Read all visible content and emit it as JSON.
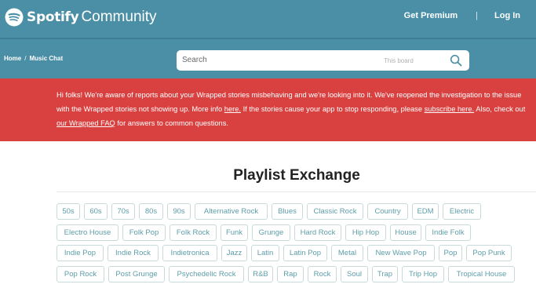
{
  "header": {
    "brand_name": "Spotify",
    "brand_suffix": "Community",
    "get_premium": "Get Premium",
    "separator": "|",
    "login": "Log In"
  },
  "breadcrumb": {
    "home": "Home",
    "separator": "/",
    "current": "Music Chat"
  },
  "search": {
    "label": "Search",
    "scope": "This board"
  },
  "alert": {
    "part1": "Hi folks! We're aware of reports about your Wrapped stories misbehaving and we're looking into it. We've reopened the investigation to the issue with the Wrapped stories not showing up. More info ",
    "link1": "here.",
    "part2": " If the stories cause your app to stop responding, please ",
    "link2": "subscribe here.",
    "part3": " Also, check out ",
    "link3": "our Wrapped FAQ",
    "part4": " for answers to common questions."
  },
  "page_title": "Playlist Exchange",
  "tags": {
    "row1": [
      "50s",
      "60s",
      "70s",
      "80s",
      "90s",
      "Alternative Rock",
      "Blues",
      "Classic Rock",
      "Country",
      "EDM",
      "Electric"
    ],
    "row2": [
      "Electro House",
      "Folk Pop",
      "Folk Rock",
      "Funk",
      "Grunge",
      "Hard Rock",
      "Hip Hop",
      "House",
      "Indie Folk"
    ],
    "row3": [
      "Indie Pop",
      "Indie Rock",
      "Indietronica",
      "Jazz",
      "Latin",
      "Latin Pop",
      "Metal",
      "New Wave Pop",
      "Pop",
      "Pop Punk"
    ],
    "row4": [
      "Pop Rock",
      "Post Grunge",
      "Psychedelic Rock",
      "R&B",
      "Rap",
      "Rock",
      "Soul",
      "Trap",
      "Trip Hop",
      "Tropical House"
    ]
  },
  "colors": {
    "header_bg": "#4a8fa5",
    "alert_bg": "#d94040",
    "tag_text": "#5e9ea8",
    "tag_border": "#c9dada"
  }
}
